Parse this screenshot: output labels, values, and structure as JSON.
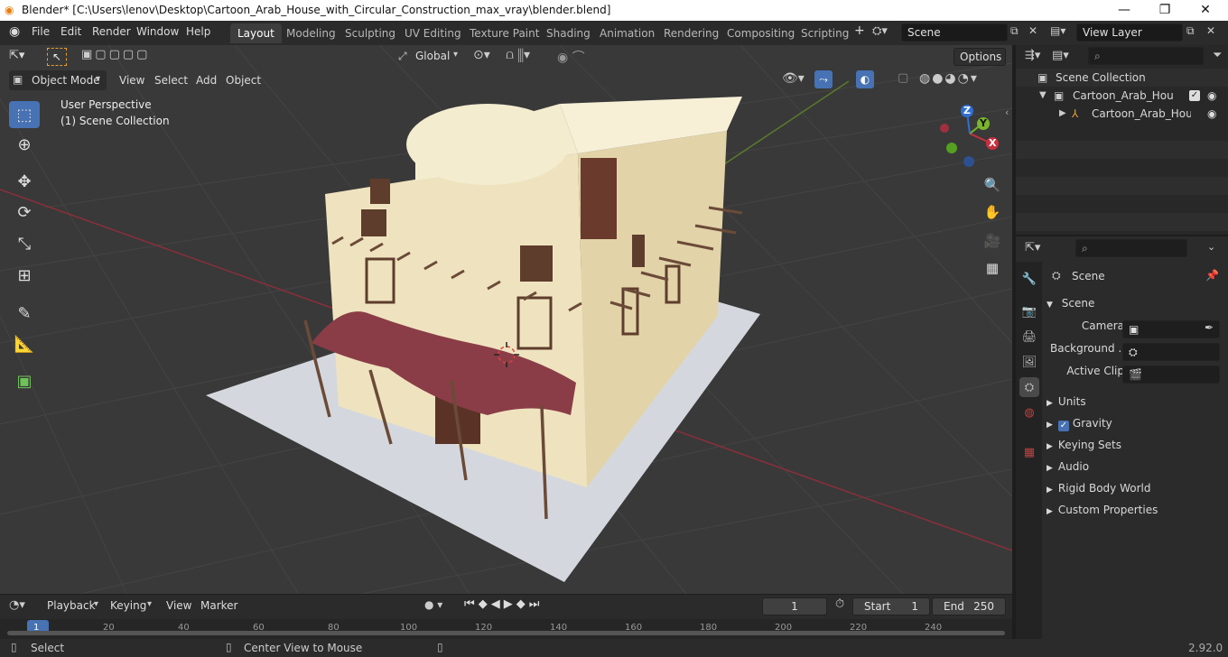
{
  "window": {
    "title": "Blender* [C:\\Users\\lenov\\Desktop\\Cartoon_Arab_House_with_Circular_Construction_max_vray\\blender.blend]",
    "minimize": "—",
    "maximize": "❐",
    "close": "✕"
  },
  "menu": [
    "File",
    "Edit",
    "Render",
    "Window",
    "Help"
  ],
  "workspaces": [
    "Layout",
    "Modeling",
    "Sculpting",
    "UV Editing",
    "Texture Paint",
    "Shading",
    "Animation",
    "Rendering",
    "Compositing",
    "Scripting"
  ],
  "active_workspace": "Layout",
  "add_workspace": "+",
  "scene_field": "Scene",
  "view_layer_field": "View Layer",
  "header": {
    "mode": "Object Mode",
    "view": "View",
    "select": "Select",
    "add": "Add",
    "object": "Object",
    "transform": "Global",
    "options": "Options"
  },
  "viewport": {
    "perspective": "User Perspective",
    "collection": "(1) Scene Collection"
  },
  "gizmo": {
    "x": "X",
    "y": "Y",
    "z": "Z"
  },
  "outliner": {
    "root": "Scene Collection",
    "collection": "Cartoon_Arab_House_wit",
    "object": "Cartoon_Arab_House"
  },
  "properties": {
    "header": "Scene",
    "panel": "Scene",
    "camera_label": "Camera",
    "background_label": "Background ...",
    "clip_label": "Active Clip",
    "panels": [
      "Units",
      "Gravity",
      "Keying Sets",
      "Audio",
      "Rigid Body World",
      "Custom Properties"
    ]
  },
  "timeline": {
    "playback": "Playback",
    "keying": "Keying",
    "view": "View",
    "marker": "Marker",
    "current_frame": "1",
    "start_label": "Start",
    "start": "1",
    "end_label": "End",
    "end": "250",
    "ticks": [
      "1",
      "20",
      "40",
      "60",
      "80",
      "100",
      "120",
      "140",
      "160",
      "180",
      "200",
      "220",
      "240"
    ]
  },
  "status": {
    "select": "Select",
    "center": "Center View to Mouse",
    "version": "2.92.0"
  },
  "colors": {
    "accent": "#4772b3",
    "awning": "#8a3d47",
    "wall": "#f1e7c6",
    "ground": "#d3d7dd",
    "x_axis": "#c9303f",
    "y_axis": "#7ab52a"
  }
}
